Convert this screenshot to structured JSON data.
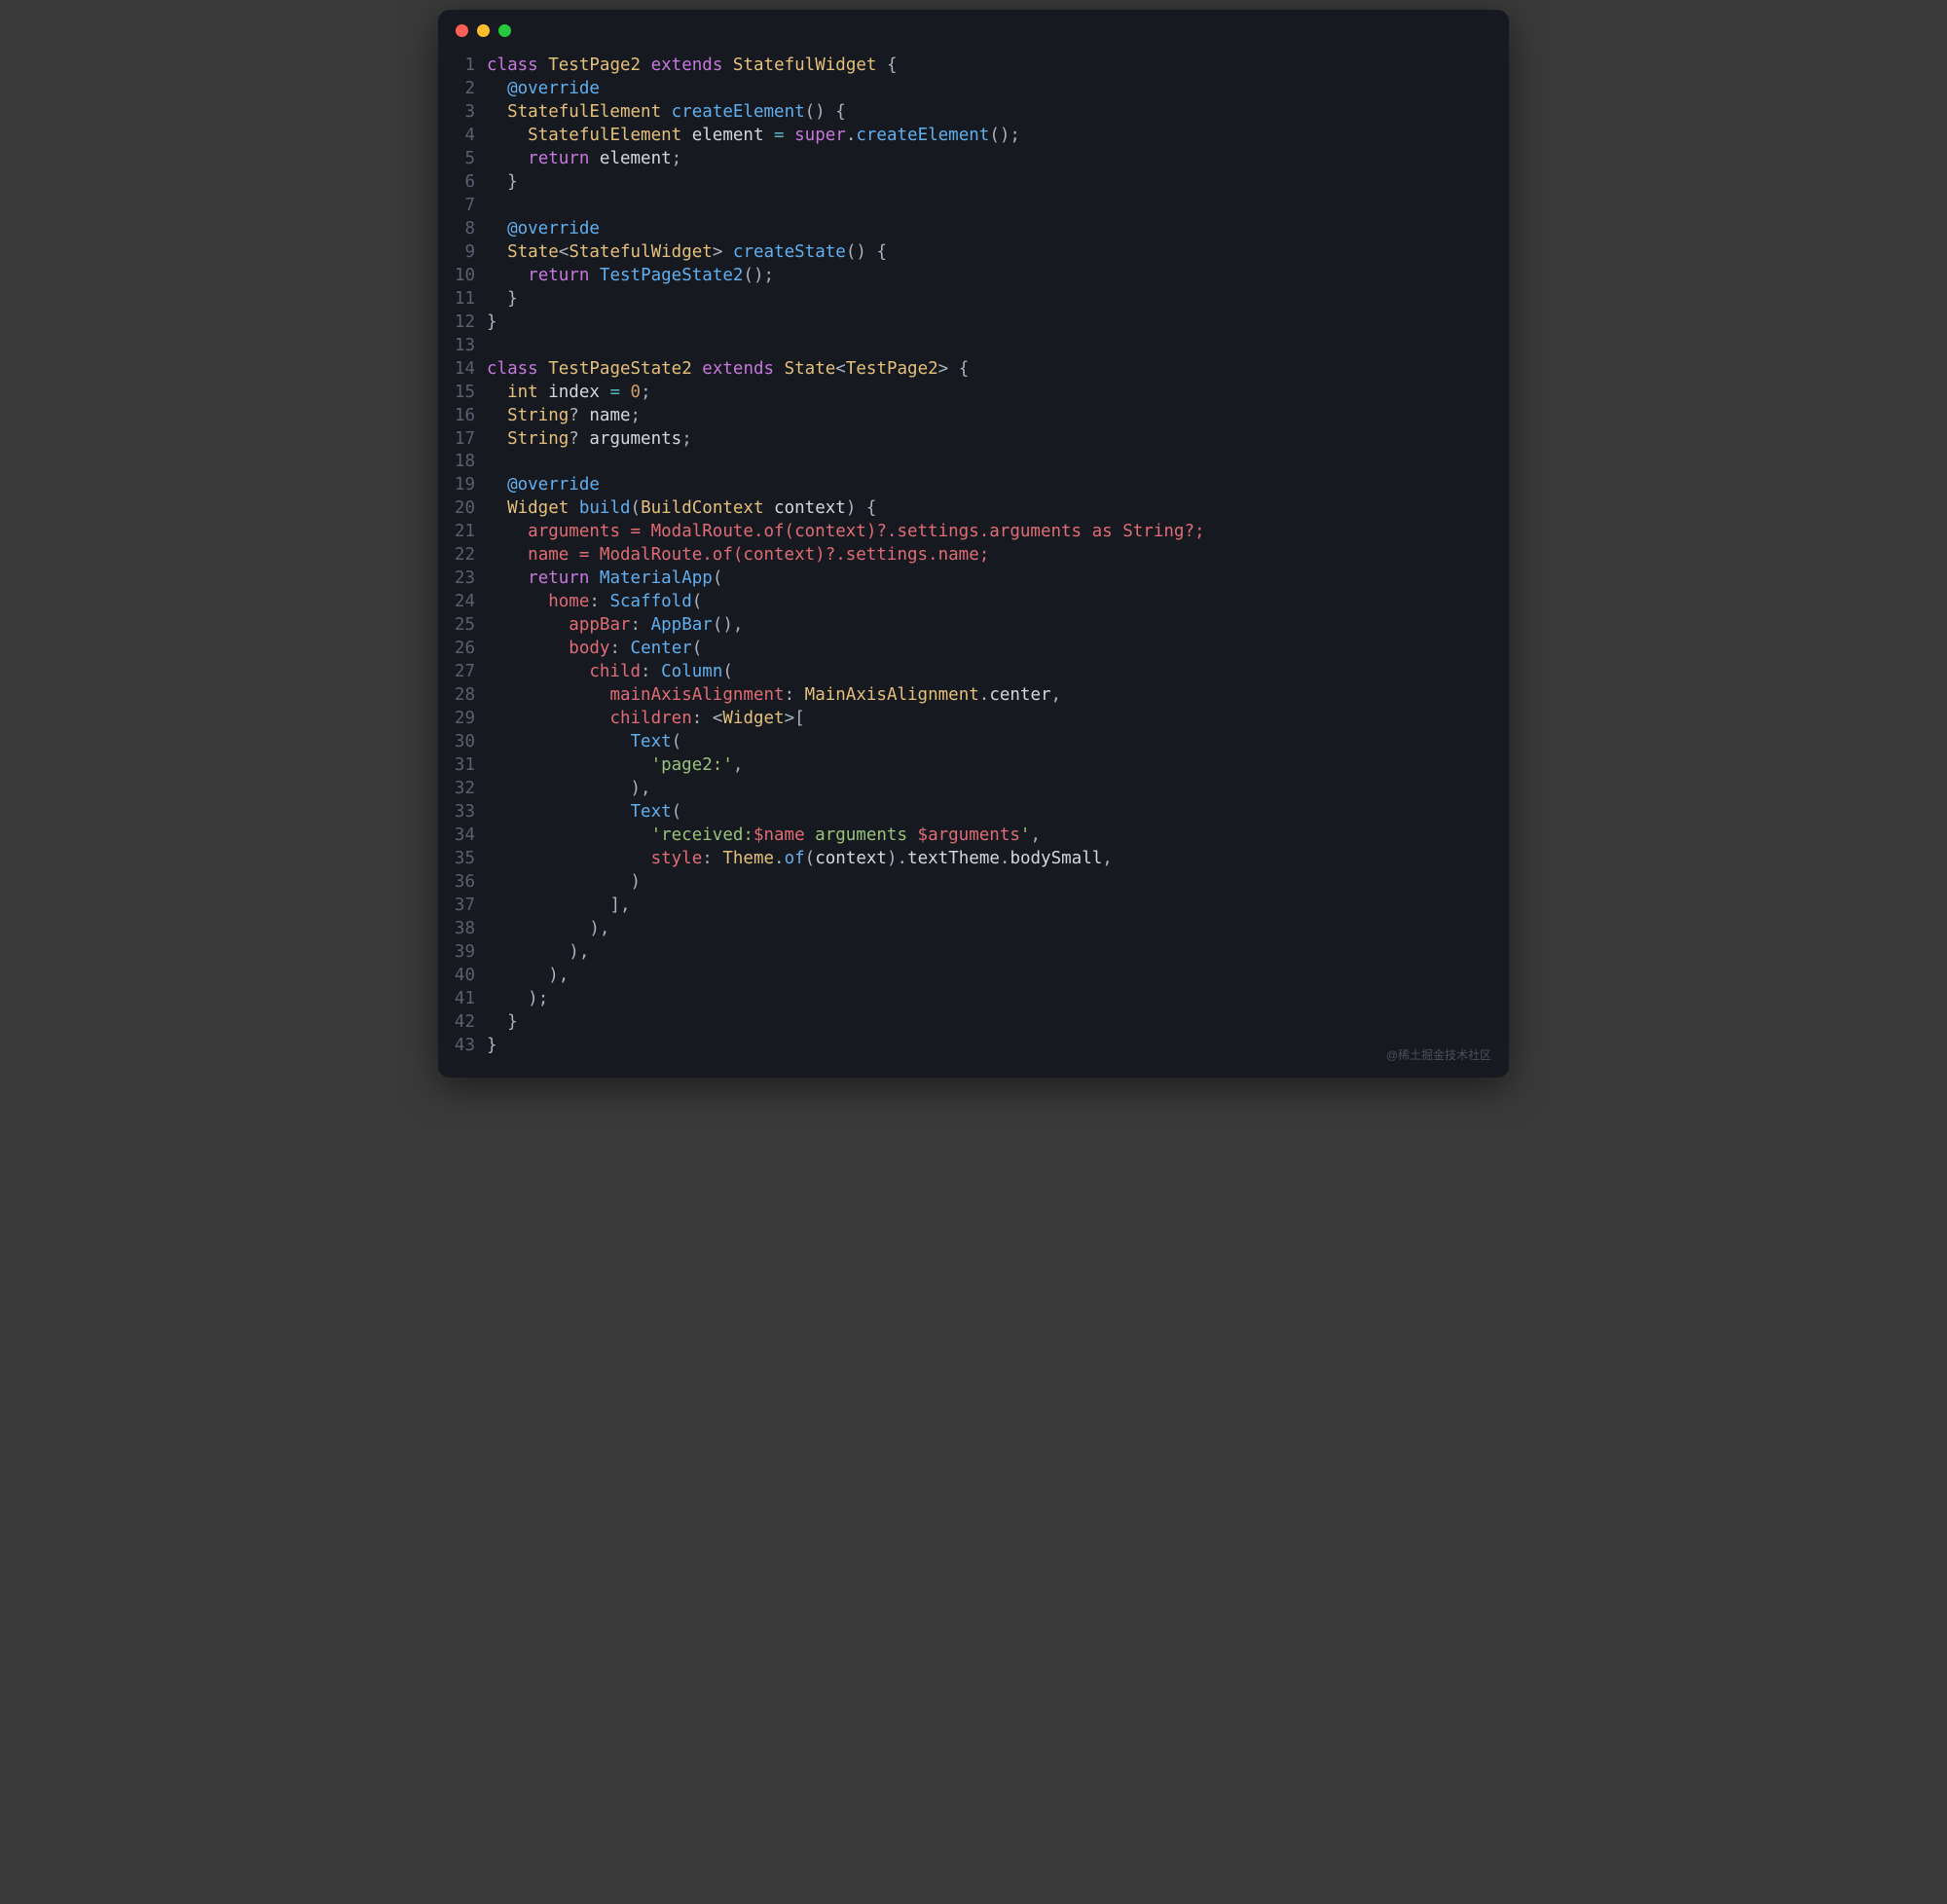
{
  "watermark": "@稀土掘金技术社区",
  "lines": [
    {
      "n": "1",
      "tokens": [
        [
          "kw",
          "class"
        ],
        [
          "",
          " "
        ],
        [
          "type",
          "TestPage2"
        ],
        [
          "",
          " "
        ],
        [
          "kw",
          "extends"
        ],
        [
          "",
          " "
        ],
        [
          "type",
          "StatefulWidget"
        ],
        [
          "",
          " "
        ],
        [
          "pun",
          "{"
        ]
      ]
    },
    {
      "n": "2",
      "tokens": [
        [
          "",
          "  "
        ],
        [
          "at",
          "@override"
        ]
      ]
    },
    {
      "n": "3",
      "tokens": [
        [
          "",
          "  "
        ],
        [
          "type",
          "StatefulElement"
        ],
        [
          "",
          " "
        ],
        [
          "fn",
          "createElement"
        ],
        [
          "pun",
          "()"
        ],
        [
          "",
          " "
        ],
        [
          "pun",
          "{"
        ]
      ]
    },
    {
      "n": "4",
      "tokens": [
        [
          "",
          "    "
        ],
        [
          "type",
          "StatefulElement"
        ],
        [
          "",
          " element "
        ],
        [
          "op",
          "="
        ],
        [
          "",
          " "
        ],
        [
          "kw",
          "super"
        ],
        [
          "pun",
          "."
        ],
        [
          "fn",
          "createElement"
        ],
        [
          "pun",
          "();"
        ]
      ]
    },
    {
      "n": "5",
      "tokens": [
        [
          "",
          "    "
        ],
        [
          "kw",
          "return"
        ],
        [
          "",
          " element"
        ],
        [
          "pun",
          ";"
        ]
      ]
    },
    {
      "n": "6",
      "tokens": [
        [
          "",
          "  "
        ],
        [
          "pun",
          "}"
        ]
      ]
    },
    {
      "n": "7",
      "tokens": []
    },
    {
      "n": "8",
      "tokens": [
        [
          "",
          "  "
        ],
        [
          "at",
          "@override"
        ]
      ]
    },
    {
      "n": "9",
      "tokens": [
        [
          "",
          "  "
        ],
        [
          "type",
          "State"
        ],
        [
          "pun",
          "<"
        ],
        [
          "type",
          "StatefulWidget"
        ],
        [
          "pun",
          ">"
        ],
        [
          "",
          " "
        ],
        [
          "fn",
          "createState"
        ],
        [
          "pun",
          "()"
        ],
        [
          "",
          " "
        ],
        [
          "pun",
          "{"
        ]
      ]
    },
    {
      "n": "10",
      "tokens": [
        [
          "",
          "    "
        ],
        [
          "kw",
          "return"
        ],
        [
          "",
          " "
        ],
        [
          "fn",
          "TestPageState2"
        ],
        [
          "pun",
          "();"
        ]
      ]
    },
    {
      "n": "11",
      "tokens": [
        [
          "",
          "  "
        ],
        [
          "pun",
          "}"
        ]
      ]
    },
    {
      "n": "12",
      "tokens": [
        [
          "pun",
          "}"
        ]
      ]
    },
    {
      "n": "13",
      "tokens": []
    },
    {
      "n": "14",
      "tokens": [
        [
          "kw",
          "class"
        ],
        [
          "",
          " "
        ],
        [
          "type",
          "TestPageState2"
        ],
        [
          "",
          " "
        ],
        [
          "kw",
          "extends"
        ],
        [
          "",
          " "
        ],
        [
          "type",
          "State"
        ],
        [
          "pun",
          "<"
        ],
        [
          "type",
          "TestPage2"
        ],
        [
          "pun",
          ">"
        ],
        [
          "",
          " "
        ],
        [
          "pun",
          "{"
        ]
      ]
    },
    {
      "n": "15",
      "tokens": [
        [
          "",
          "  "
        ],
        [
          "type",
          "int"
        ],
        [
          "",
          " index "
        ],
        [
          "op",
          "="
        ],
        [
          "",
          " "
        ],
        [
          "num",
          "0"
        ],
        [
          "pun",
          ";"
        ]
      ]
    },
    {
      "n": "16",
      "tokens": [
        [
          "",
          "  "
        ],
        [
          "type",
          "String"
        ],
        [
          "pun",
          "?"
        ],
        [
          "",
          " name"
        ],
        [
          "pun",
          ";"
        ]
      ]
    },
    {
      "n": "17",
      "tokens": [
        [
          "",
          "  "
        ],
        [
          "type",
          "String"
        ],
        [
          "pun",
          "?"
        ],
        [
          "",
          " arguments"
        ],
        [
          "pun",
          ";"
        ]
      ]
    },
    {
      "n": "18",
      "tokens": []
    },
    {
      "n": "19",
      "tokens": [
        [
          "",
          "  "
        ],
        [
          "at",
          "@override"
        ]
      ]
    },
    {
      "n": "20",
      "tokens": [
        [
          "",
          "  "
        ],
        [
          "type",
          "Widget"
        ],
        [
          "",
          " "
        ],
        [
          "fn",
          "build"
        ],
        [
          "pun",
          "("
        ],
        [
          "type",
          "BuildContext"
        ],
        [
          "",
          " context"
        ],
        [
          "pun",
          ")"
        ],
        [
          "",
          " "
        ],
        [
          "pun",
          "{"
        ]
      ]
    },
    {
      "n": "21",
      "tokens": [
        [
          "",
          "    "
        ],
        [
          "redline",
          "arguments = ModalRoute.of(context)?.settings.arguments as String?;"
        ]
      ]
    },
    {
      "n": "22",
      "tokens": [
        [
          "",
          "    "
        ],
        [
          "redline",
          "name = ModalRoute.of(context)?.settings.name;"
        ]
      ]
    },
    {
      "n": "23",
      "tokens": [
        [
          "",
          "    "
        ],
        [
          "kw",
          "return"
        ],
        [
          "",
          " "
        ],
        [
          "fn",
          "MaterialApp"
        ],
        [
          "pun",
          "("
        ]
      ]
    },
    {
      "n": "24",
      "tokens": [
        [
          "",
          "      "
        ],
        [
          "named",
          "home"
        ],
        [
          "pun",
          ":"
        ],
        [
          "",
          " "
        ],
        [
          "fn",
          "Scaffold"
        ],
        [
          "pun",
          "("
        ]
      ]
    },
    {
      "n": "25",
      "tokens": [
        [
          "",
          "        "
        ],
        [
          "named",
          "appBar"
        ],
        [
          "pun",
          ":"
        ],
        [
          "",
          " "
        ],
        [
          "fn",
          "AppBar"
        ],
        [
          "pun",
          "(),"
        ]
      ]
    },
    {
      "n": "26",
      "tokens": [
        [
          "",
          "        "
        ],
        [
          "named",
          "body"
        ],
        [
          "pun",
          ":"
        ],
        [
          "",
          " "
        ],
        [
          "fn",
          "Center"
        ],
        [
          "pun",
          "("
        ]
      ]
    },
    {
      "n": "27",
      "tokens": [
        [
          "",
          "          "
        ],
        [
          "named",
          "child"
        ],
        [
          "pun",
          ":"
        ],
        [
          "",
          " "
        ],
        [
          "fn",
          "Column"
        ],
        [
          "pun",
          "("
        ]
      ]
    },
    {
      "n": "28",
      "tokens": [
        [
          "",
          "            "
        ],
        [
          "named",
          "mainAxisAlignment"
        ],
        [
          "pun",
          ":"
        ],
        [
          "",
          " "
        ],
        [
          "type",
          "MainAxisAlignment"
        ],
        [
          "pun",
          "."
        ],
        [
          "",
          "center"
        ],
        [
          "pun",
          ","
        ]
      ]
    },
    {
      "n": "29",
      "tokens": [
        [
          "",
          "            "
        ],
        [
          "named",
          "children"
        ],
        [
          "pun",
          ":"
        ],
        [
          "",
          " "
        ],
        [
          "pun",
          "<"
        ],
        [
          "type",
          "Widget"
        ],
        [
          "pun",
          ">["
        ]
      ]
    },
    {
      "n": "30",
      "tokens": [
        [
          "",
          "              "
        ],
        [
          "fn",
          "Text"
        ],
        [
          "pun",
          "("
        ]
      ]
    },
    {
      "n": "31",
      "tokens": [
        [
          "",
          "                "
        ],
        [
          "str",
          "'page2:'"
        ],
        [
          "pun",
          ","
        ]
      ]
    },
    {
      "n": "32",
      "tokens": [
        [
          "",
          "              "
        ],
        [
          "pun",
          "),"
        ]
      ]
    },
    {
      "n": "33",
      "tokens": [
        [
          "",
          "              "
        ],
        [
          "fn",
          "Text"
        ],
        [
          "pun",
          "("
        ]
      ]
    },
    {
      "n": "34",
      "tokens": [
        [
          "",
          "                "
        ],
        [
          "str",
          "'received:"
        ],
        [
          "named",
          "$name"
        ],
        [
          "str",
          " arguments "
        ],
        [
          "named",
          "$arguments"
        ],
        [
          "str",
          "'"
        ],
        [
          "pun",
          ","
        ]
      ]
    },
    {
      "n": "35",
      "tokens": [
        [
          "",
          "                "
        ],
        [
          "named",
          "style"
        ],
        [
          "pun",
          ":"
        ],
        [
          "",
          " "
        ],
        [
          "type",
          "Theme"
        ],
        [
          "pun",
          "."
        ],
        [
          "fn",
          "of"
        ],
        [
          "pun",
          "("
        ],
        [
          "",
          "context"
        ],
        [
          "pun",
          ")."
        ],
        [
          "",
          "textTheme"
        ],
        [
          "pun",
          "."
        ],
        [
          "",
          "bodySmall"
        ],
        [
          "pun",
          ","
        ]
      ]
    },
    {
      "n": "36",
      "tokens": [
        [
          "",
          "              "
        ],
        [
          "pun",
          ")"
        ]
      ]
    },
    {
      "n": "37",
      "tokens": [
        [
          "",
          "            "
        ],
        [
          "pun",
          "],"
        ]
      ]
    },
    {
      "n": "38",
      "tokens": [
        [
          "",
          "          "
        ],
        [
          "pun",
          "),"
        ]
      ]
    },
    {
      "n": "39",
      "tokens": [
        [
          "",
          "        "
        ],
        [
          "pun",
          "),"
        ]
      ]
    },
    {
      "n": "40",
      "tokens": [
        [
          "",
          "      "
        ],
        [
          "pun",
          "),"
        ]
      ]
    },
    {
      "n": "41",
      "tokens": [
        [
          "",
          "    "
        ],
        [
          "pun",
          ");"
        ]
      ]
    },
    {
      "n": "42",
      "tokens": [
        [
          "",
          "  "
        ],
        [
          "pun",
          "}"
        ]
      ]
    },
    {
      "n": "43",
      "tokens": [
        [
          "pun",
          "}"
        ]
      ]
    }
  ]
}
